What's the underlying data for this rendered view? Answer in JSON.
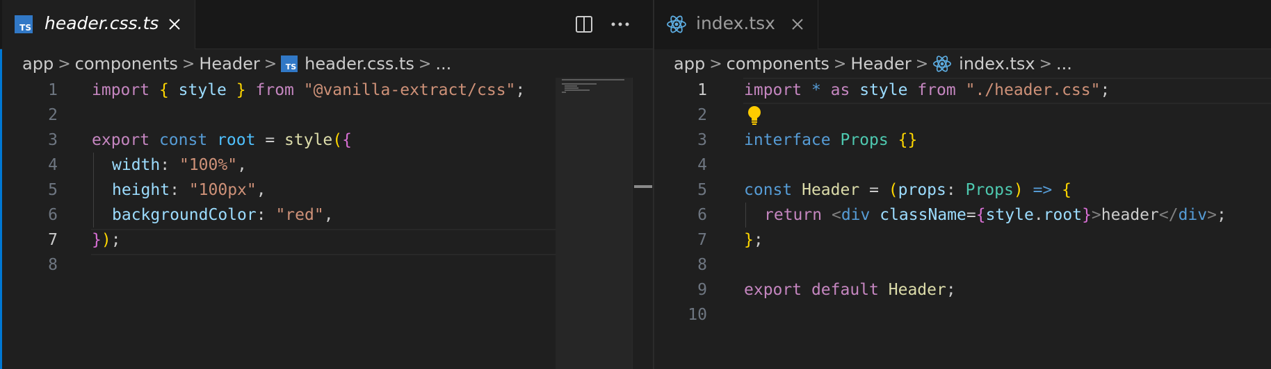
{
  "left_pane": {
    "tab": {
      "label": "header.css.ts",
      "icon": "typescript-file-icon",
      "badge": "TS"
    },
    "actions": [
      "split-editor-icon",
      "more-actions-icon"
    ],
    "breadcrumb": [
      "app",
      "components",
      "Header",
      "header.css.ts",
      "..."
    ],
    "line_numbers": [
      "1",
      "2",
      "3",
      "4",
      "5",
      "6",
      "7",
      "8"
    ],
    "current_line": "7"
  },
  "right_pane": {
    "tab": {
      "label": "index.tsx",
      "icon": "react-file-icon"
    },
    "breadcrumb": [
      "app",
      "components",
      "Header",
      "index.tsx",
      "..."
    ],
    "line_numbers": [
      "1",
      "2",
      "3",
      "4",
      "5",
      "6",
      "7",
      "8",
      "9",
      "10"
    ],
    "current_line": "1"
  },
  "left_code": {
    "l1": {
      "a": "import",
      "b": "{",
      "c": "style",
      "d": "}",
      "e": "from",
      "f": "\"@vanilla-extract/css\"",
      "g": ";"
    },
    "l3": {
      "a": "export",
      "b": "const",
      "c": "root",
      "d": "=",
      "e": "style",
      "f": "(",
      "g": "{"
    },
    "l4": {
      "a": "width",
      "b": ":",
      "c": "\"100%\"",
      "d": ","
    },
    "l5": {
      "a": "height",
      "b": ":",
      "c": "\"100px\"",
      "d": ","
    },
    "l6": {
      "a": "backgroundColor",
      "b": ":",
      "c": "\"red\"",
      "d": ","
    },
    "l7": {
      "a": "}",
      "b": ")",
      "c": ";"
    }
  },
  "right_code": {
    "l1": {
      "a": "import",
      "b": "*",
      "c": "as",
      "d": "style",
      "e": "from",
      "f": "\"./header.css\"",
      "g": ";"
    },
    "l3": {
      "a": "interface",
      "b": "Props",
      "c": "{}"
    },
    "l5": {
      "a": "const",
      "b": "Header",
      "c": "=",
      "d": "(",
      "e": "props",
      "f": ":",
      "g": "Props",
      "h": ")",
      "i": "=>",
      "j": "{"
    },
    "l6": {
      "a": "return",
      "b": "<",
      "c": "div",
      "d": "className",
      "e": "=",
      "f": "{",
      "g": "style",
      "h": ".",
      "i": "root",
      "j": "}",
      "k": ">",
      "l": "header",
      "m": "</",
      "n": "div",
      "o": ">",
      "p": ";"
    },
    "l7": {
      "a": "}",
      "b": ";"
    },
    "l9": {
      "a": "export",
      "b": "default",
      "c": "Header",
      "d": ";"
    }
  },
  "colors": {
    "accent": "#0078d4",
    "editor_bg": "#1f1f1f",
    "ts_badge": "#3178c6",
    "react_icon": "#5dade2",
    "lightbulb": "#ffcc00"
  }
}
